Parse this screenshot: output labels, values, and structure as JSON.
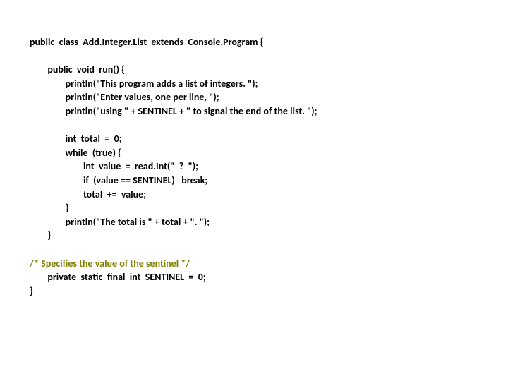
{
  "code": {
    "l1_a": "public  class  Add.Integer.List  extends  Console.Program {",
    "l2_a": "        public  void  run() {",
    "l3_a": "                println(\"This program adds a list of integers. \");",
    "l4_a": "                println(\"Enter values, one per line, \");",
    "l5_a": "                println(\"using \" + SENTINEL + \" to signal the end of the list. \");",
    "l6_a": "                int  total  =  0;",
    "l7_a": "                while  (true) {",
    "l8_a": "                        int  value  =  read.Int(\"  ?  \");",
    "l9_a": "                        if  (value == SENTINEL)   break;",
    "l10_a": "                        total  +=  value;",
    "l11_a": "                }",
    "l12_a": "                println(\"The total is \" + total + \". \");",
    "l13_a": "        }",
    "l14_a": "/* Specifies the value of the sentinel */",
    "l15_a": "        private  static  final  int  SENTINEL  =  0;",
    "l16_a": "}"
  }
}
